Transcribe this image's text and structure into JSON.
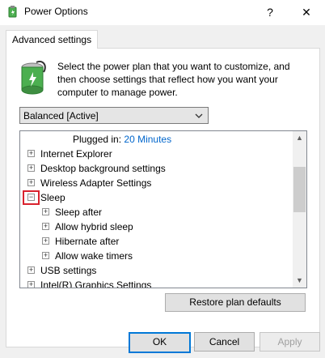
{
  "window": {
    "title": "Power Options",
    "help": "?",
    "close": "✕"
  },
  "tab": {
    "label": "Advanced settings"
  },
  "instructions": "Select the power plan that you want to customize, and then choose settings that reflect how you want your computer to manage power.",
  "plan_select": {
    "value": "Balanced [Active]"
  },
  "tree": {
    "plugged_in_label": "Plugged in:",
    "plugged_in_value": "20 Minutes",
    "items": [
      {
        "label": "Internet Explorer",
        "expander": "+"
      },
      {
        "label": "Desktop background settings",
        "expander": "+"
      },
      {
        "label": "Wireless Adapter Settings",
        "expander": "+"
      },
      {
        "label": "Sleep",
        "expander": "−"
      },
      {
        "label": "Sleep after",
        "expander": "+"
      },
      {
        "label": "Allow hybrid sleep",
        "expander": "+"
      },
      {
        "label": "Hibernate after",
        "expander": "+"
      },
      {
        "label": "Allow wake timers",
        "expander": "+"
      },
      {
        "label": "USB settings",
        "expander": "+"
      },
      {
        "label": "Intel(R) Graphics Settings",
        "expander": "+"
      }
    ]
  },
  "buttons": {
    "restore": "Restore plan defaults",
    "ok": "OK",
    "cancel": "Cancel",
    "apply": "Apply"
  },
  "colors": {
    "highlight": "#d9232e",
    "link": "#0066cc",
    "accent": "#0078d7"
  },
  "icons": {
    "app": "power-options-icon",
    "battery": "battery-icon",
    "dropdown": "chevron-down-icon"
  }
}
